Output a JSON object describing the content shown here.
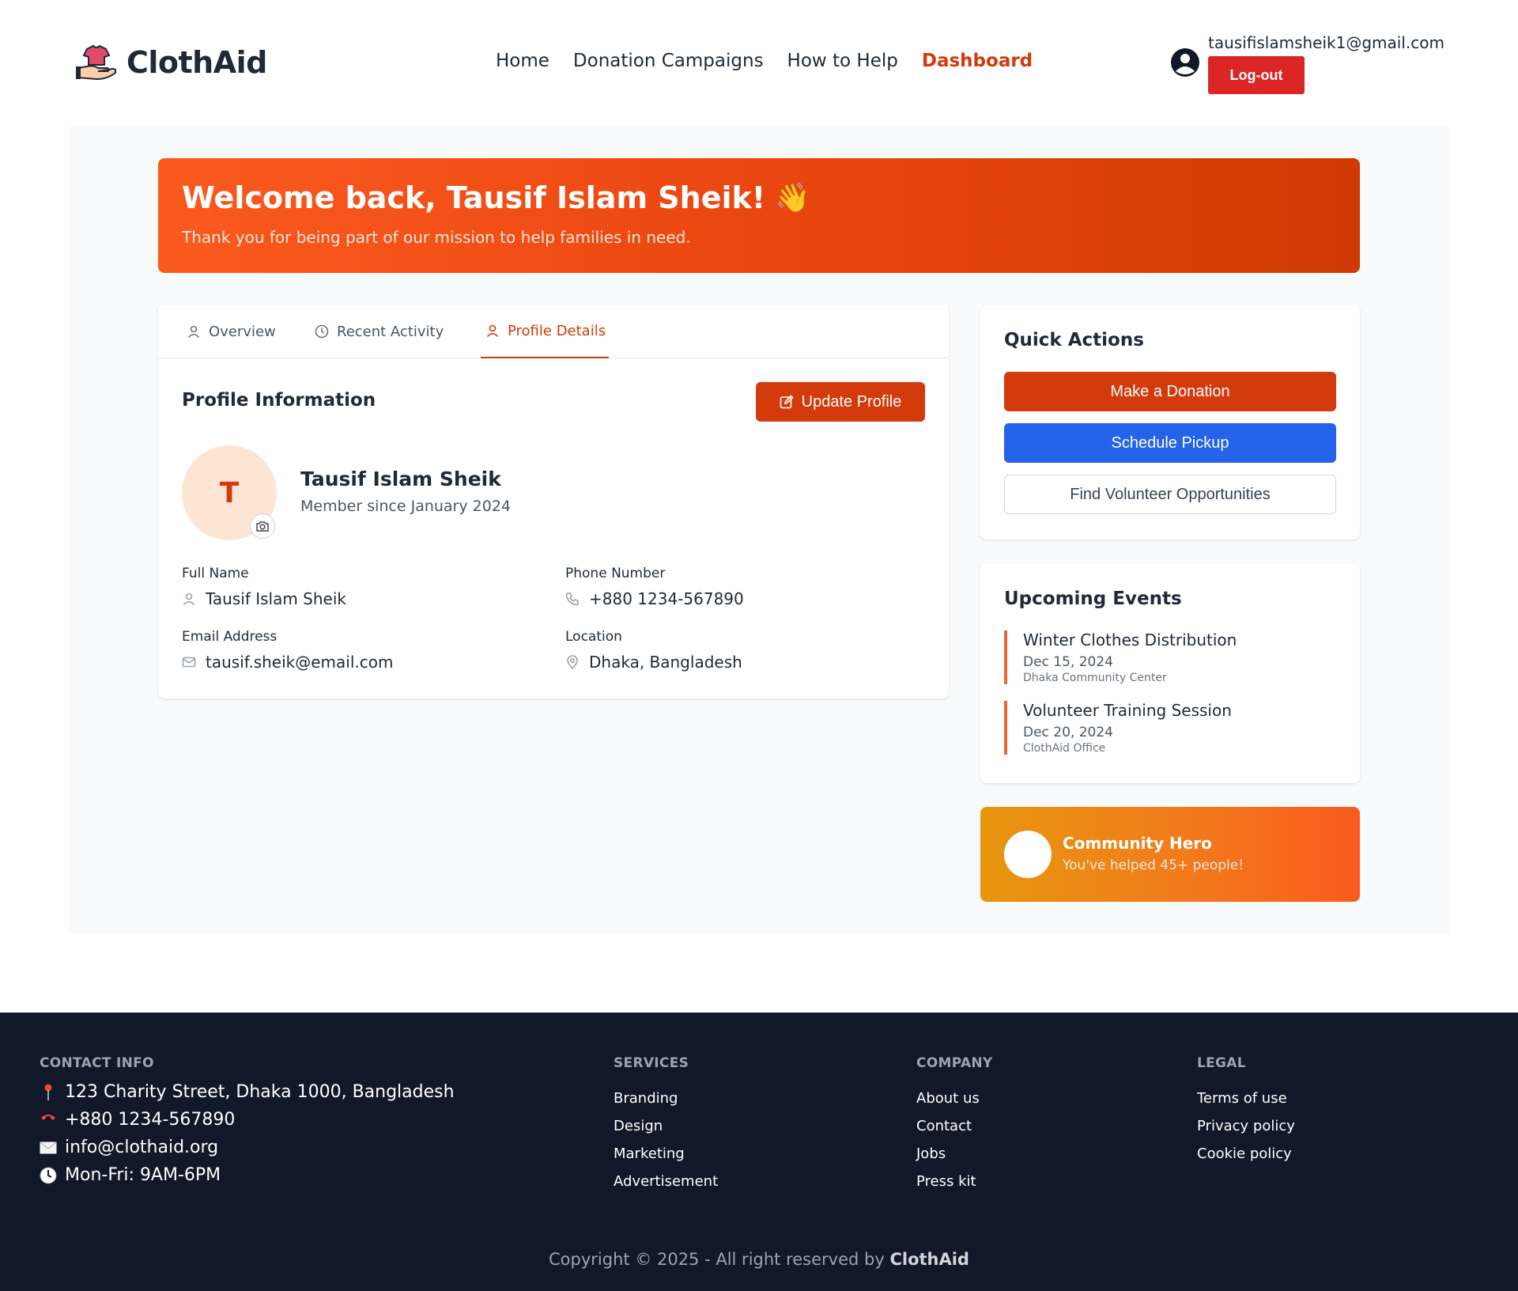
{
  "nav": {
    "logo_text": "ClothAid",
    "links": [
      "Home",
      "Donation Campaigns",
      "How to Help",
      "Dashboard"
    ],
    "active_link": "Dashboard",
    "user_email": "tausifislamsheik1@gmail.com",
    "logout_label": "Log-out"
  },
  "welcome": {
    "title": "Welcome back, Tausif Islam Sheik!",
    "emoji": "👋",
    "subtitle": "Thank you for being part of our mission to help families in need."
  },
  "tabs": [
    {
      "label": "Overview",
      "icon": "user-icon"
    },
    {
      "label": "Recent Activity",
      "icon": "clock-icon"
    },
    {
      "label": "Profile Details",
      "icon": "user-icon",
      "active": true
    }
  ],
  "profile": {
    "section_title": "Profile Information",
    "update_label": "Update Profile",
    "avatar_initial": "T",
    "name": "Tausif Islam Sheik",
    "member_since": "Member since January 2024",
    "fields": {
      "full_name_label": "Full Name",
      "full_name": "Tausif Islam Sheik",
      "phone_label": "Phone Number",
      "phone": "+880 1234-567890",
      "email_label": "Email Address",
      "email": "tausif.sheik@email.com",
      "location_label": "Location",
      "location": "Dhaka, Bangladesh"
    }
  },
  "quick_actions": {
    "title": "Quick Actions",
    "donate": "Make a Donation",
    "pickup": "Schedule Pickup",
    "volunteer": "Find Volunteer Opportunities"
  },
  "events": {
    "title": "Upcoming Events",
    "items": [
      {
        "title": "Winter Clothes Distribution",
        "date": "Dec 15, 2024",
        "location": "Dhaka Community Center"
      },
      {
        "title": "Volunteer Training Session",
        "date": "Dec 20, 2024",
        "location": "ClothAid Office"
      }
    ]
  },
  "hero": {
    "title": "Community Hero",
    "subtitle": "You've helped 45+ people!"
  },
  "footer": {
    "contact_title": "CONTACT INFO",
    "contact": [
      {
        "icon": "pin-icon",
        "text": "123 Charity Street, Dhaka 1000, Bangladesh"
      },
      {
        "icon": "phone-icon",
        "text": "+880 1234-567890"
      },
      {
        "icon": "envelope-icon",
        "text": "info@clothaid.org"
      },
      {
        "icon": "clock-icon",
        "text": "Mon-Fri: 9AM-6PM"
      }
    ],
    "services_title": "SERVICES",
    "services": [
      "Branding",
      "Design",
      "Marketing",
      "Advertisement"
    ],
    "company_title": "COMPANY",
    "company": [
      "About us",
      "Contact",
      "Jobs",
      "Press kit"
    ],
    "legal_title": "LEGAL",
    "legal": [
      "Terms of use",
      "Privacy policy",
      "Cookie policy"
    ],
    "copyright_prefix": "Copyright © 2025 - All right reserved by ",
    "copyright_brand": "ClothAid"
  },
  "colors": {
    "accent": "#d33a0c",
    "blue": "#2563eb",
    "logout": "#dc2626",
    "footer_bg": "#111827"
  }
}
